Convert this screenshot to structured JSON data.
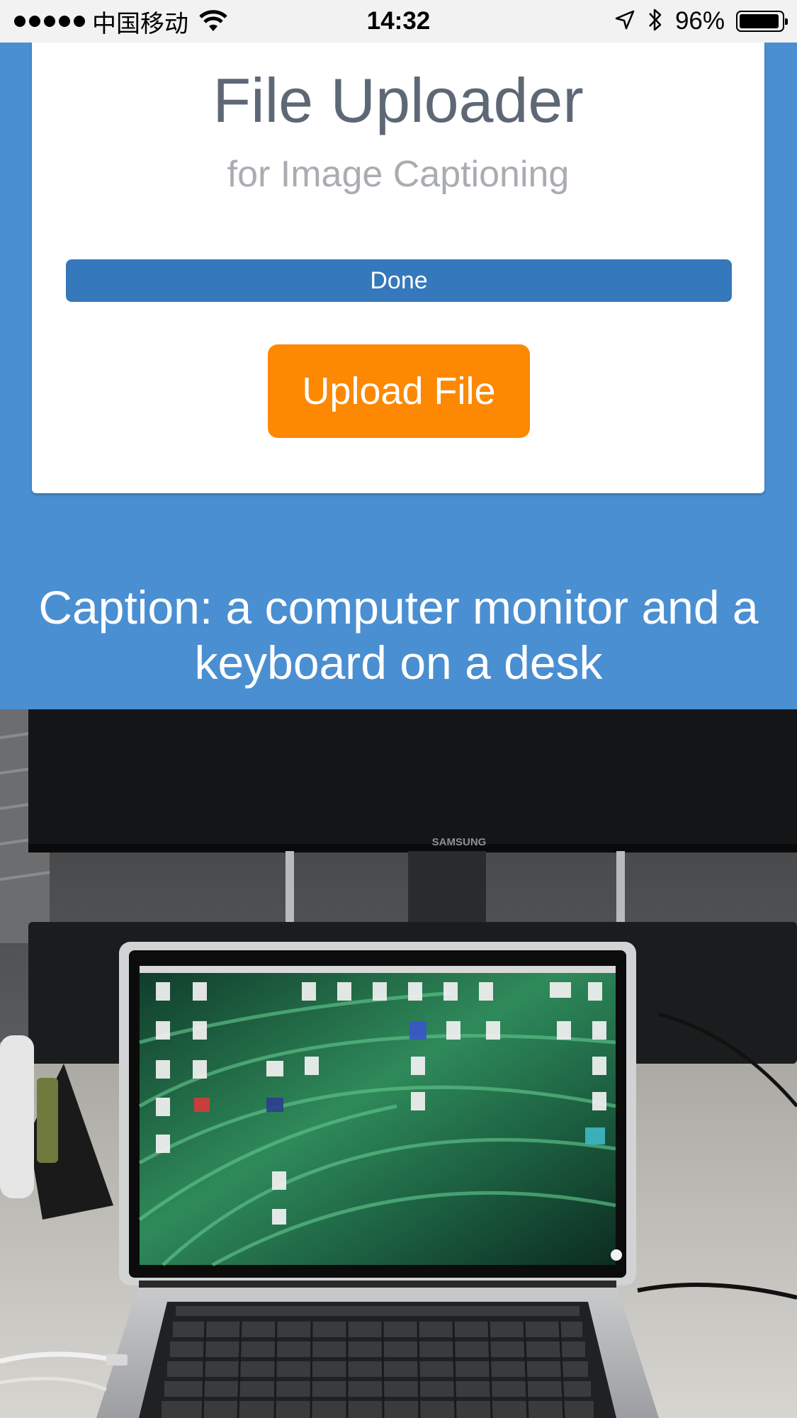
{
  "status_bar": {
    "carrier": "中国移动",
    "time": "14:32",
    "battery_percent": "96%",
    "battery_level": 0.96,
    "icons": [
      "signal-dots-icon",
      "wifi-icon",
      "location-arrow-icon",
      "bluetooth-icon",
      "battery-icon"
    ]
  },
  "uploader": {
    "title": "File Uploader",
    "subtitle": "for Image Captioning",
    "progress_label": "Done",
    "progress_fraction": 1.0,
    "upload_button_label": "Upload File"
  },
  "caption": {
    "text": "Caption: a computer monitor and a keyboard on a desk"
  },
  "photo": {
    "monitor_brand": "SAMSUNG"
  },
  "colors": {
    "page_background": "#4a8fd1",
    "progress_fill": "#3578bb",
    "upload_button": "#fd8802",
    "title_text": "#5e6875",
    "subtitle_text": "#a9acb1"
  }
}
